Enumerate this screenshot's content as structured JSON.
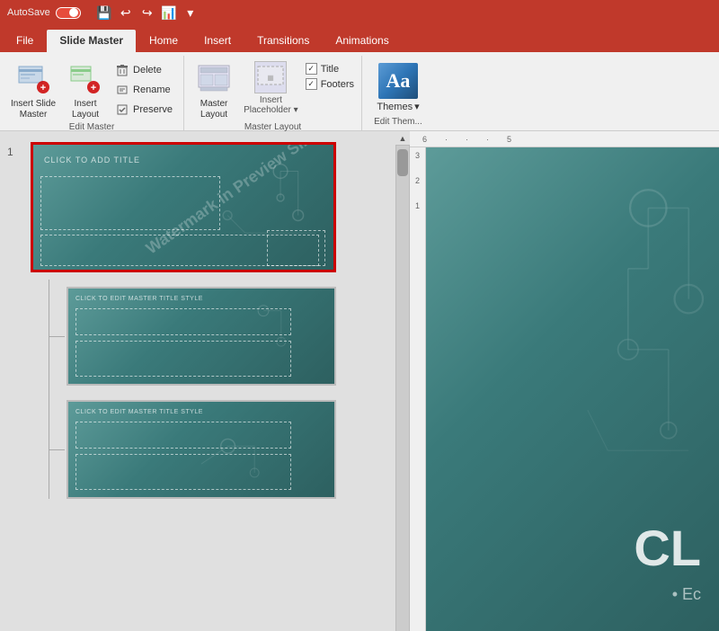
{
  "titlebar": {
    "autosave_label": "AutoSave",
    "toggle_state": "off",
    "app_name": ""
  },
  "ribbon": {
    "tabs": [
      {
        "id": "file",
        "label": "File"
      },
      {
        "id": "slide-master",
        "label": "Slide Master",
        "active": true
      },
      {
        "id": "home",
        "label": "Home"
      },
      {
        "id": "insert",
        "label": "Insert"
      },
      {
        "id": "transitions",
        "label": "Transitions"
      },
      {
        "id": "animations",
        "label": "Animations"
      }
    ],
    "groups": {
      "edit_master": {
        "label": "Edit Master",
        "insert_slide_master": "Insert Slide\nMaster",
        "insert_layout": "Insert\nLayout",
        "delete": "Delete",
        "rename": "Rename",
        "preserve": "Preserve"
      },
      "master_layout": {
        "label": "Master Layout",
        "master_layout_btn": "Master\nLayout",
        "insert_placeholder": "Insert\nPlaceholder",
        "title_label": "Title",
        "footers_label": "Footers"
      },
      "edit_theme": {
        "label": "Edit Them...",
        "themes_btn": "Themes",
        "themes_icon_text": "Aa"
      }
    }
  },
  "slides": [
    {
      "number": "1",
      "type": "master",
      "title_text": "CLICK TO ADD TITLE",
      "diagonal_text": "Watermark in Preview Slide",
      "selected": true
    },
    {
      "number": "",
      "type": "layout",
      "title_text": "CLICK TO EDIT MASTER TITLE STYLE",
      "selected": false
    },
    {
      "number": "",
      "type": "layout",
      "title_text": "CLICK TO EDIT MASTER TITLE STYLE",
      "selected": false
    }
  ],
  "canvas": {
    "large_text": "CL",
    "bullet_text": "• Ec"
  },
  "ruler": {
    "h_marks": [
      "6",
      "·",
      "·",
      "·",
      "·",
      "5"
    ],
    "v_marks": [
      "3",
      "2",
      "1"
    ]
  }
}
